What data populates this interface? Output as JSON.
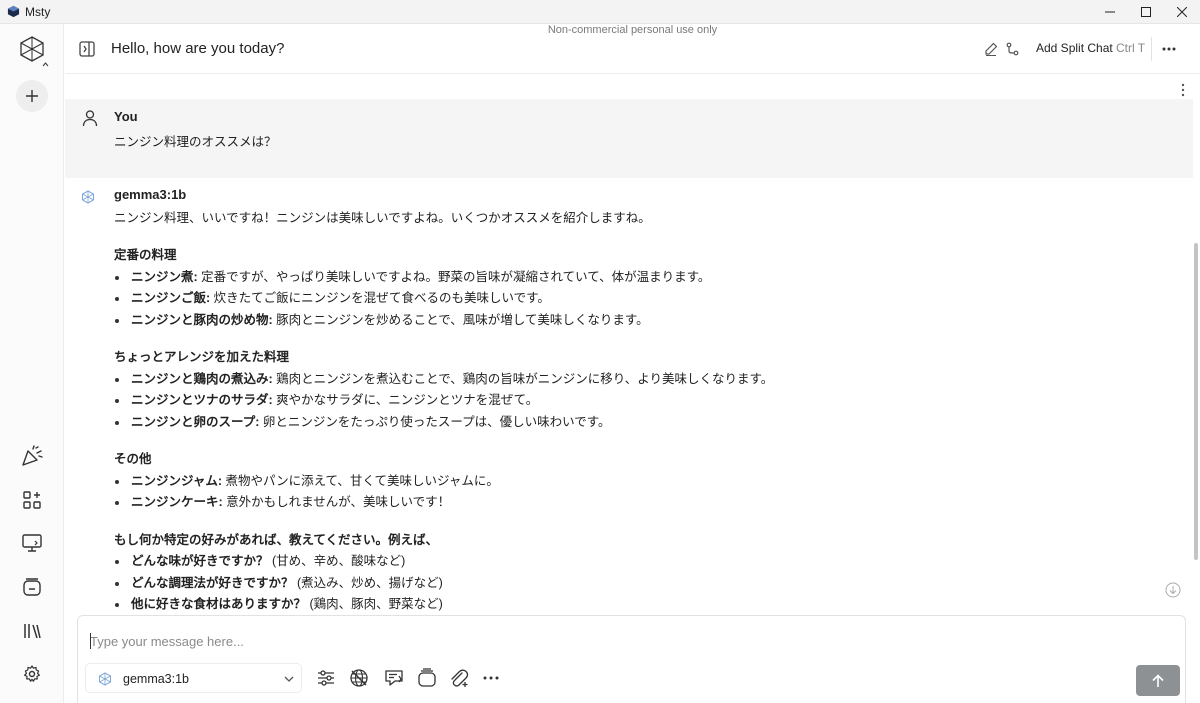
{
  "app": {
    "title": "Msty"
  },
  "header": {
    "notice": "Non-commercial personal use only",
    "chat_title": "Hello, how are you today?",
    "split_label": "Add Split Chat",
    "split_shortcut": "Ctrl T"
  },
  "user_message": {
    "author": "You",
    "text": "ニンジン料理のオススメは？"
  },
  "ai_message": {
    "author": "gemma3:1b",
    "intro": "ニンジン料理、いいですね！ニンジンは美味しいですよね。いくつかオススメを紹介しますね。",
    "sections": [
      {
        "heading": "定番の料理",
        "items": [
          {
            "term": "ニンジン煮:",
            "desc": "定番ですが、やっぱり美味しいですよね。野菜の旨味が凝縮されていて、体が温まります。"
          },
          {
            "term": "ニンジンご飯:",
            "desc": "炊きたてご飯にニンジンを混ぜて食べるのも美味しいです。"
          },
          {
            "term": "ニンジンと豚肉の炒め物:",
            "desc": "豚肉とニンジンを炒めることで、風味が増して美味しくなります。"
          }
        ]
      },
      {
        "heading": "ちょっとアレンジを加えた料理",
        "items": [
          {
            "term": "ニンジンと鶏肉の煮込み:",
            "desc": "鶏肉とニンジンを煮込むことで、鶏肉の旨味がニンジンに移り、より美味しくなります。"
          },
          {
            "term": "ニンジンとツナのサラダ:",
            "desc": "爽やかなサラダに、ニンジンとツナを混ぜて。"
          },
          {
            "term": "ニンジンと卵のスープ:",
            "desc": "卵とニンジンをたっぷり使ったスープは、優しい味わいです。"
          }
        ]
      },
      {
        "heading": "その他",
        "items": [
          {
            "term": "ニンジンジャム:",
            "desc": "煮物やパンに添えて、甘くて美味しいジャムに。"
          },
          {
            "term": "ニンジンケーキ:",
            "desc": "意外かもしれませんが、美味しいです！"
          }
        ]
      },
      {
        "heading": "もし何か特定の好みがあれば、教えてください。例えば、",
        "items": [
          {
            "term": "どんな味が好きですか？",
            "desc": "(甘め、辛め、酸味など)"
          },
          {
            "term": "どんな調理法が好きですか？",
            "desc": "(煮込み、炒め、揚げなど)"
          },
          {
            "term": "他に好きな食材はありますか？",
            "desc": "(鶏肉、豚肉、野菜など)"
          }
        ]
      }
    ]
  },
  "composer": {
    "placeholder": "Type your message here...",
    "model": "gemma3:1b"
  },
  "colors": {
    "send_button": "#8e9194",
    "user_bubble": "#f5f5f5"
  },
  "icons": {
    "rail": [
      "msty-logo-icon",
      "plus-icon",
      "sparkles-icon",
      "apps-icon",
      "monitor-icon",
      "archive-icon",
      "library-icon",
      "gear-icon"
    ],
    "toolbar": [
      "sliders-icon",
      "globe-off-icon",
      "prompt-icon",
      "stack-icon",
      "attach-icon",
      "more-icon"
    ]
  }
}
